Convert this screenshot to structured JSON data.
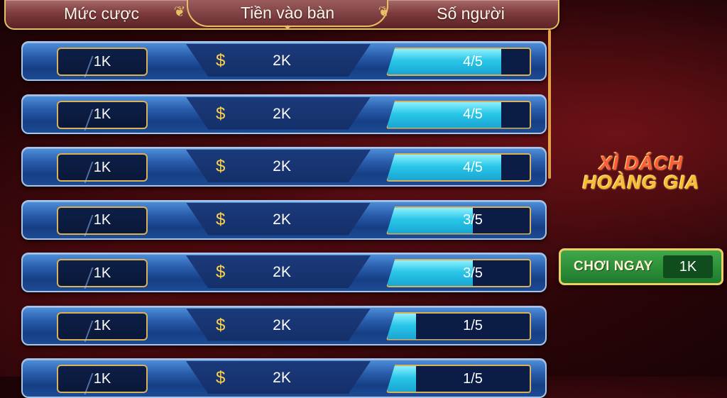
{
  "header": {
    "col_bet": "Mức cược",
    "col_entry": "Tiền vào bàn",
    "col_players": "Số người"
  },
  "rows": [
    {
      "bet": "1K",
      "currency": "$",
      "entry": "2K",
      "players": "4/5",
      "fill": 0.8
    },
    {
      "bet": "1K",
      "currency": "$",
      "entry": "2K",
      "players": "4/5",
      "fill": 0.8
    },
    {
      "bet": "1K",
      "currency": "$",
      "entry": "2K",
      "players": "4/5",
      "fill": 0.8
    },
    {
      "bet": "1K",
      "currency": "$",
      "entry": "2K",
      "players": "3/5",
      "fill": 0.6
    },
    {
      "bet": "1K",
      "currency": "$",
      "entry": "2K",
      "players": "3/5",
      "fill": 0.6
    },
    {
      "bet": "1K",
      "currency": "$",
      "entry": "2K",
      "players": "1/5",
      "fill": 0.2
    },
    {
      "bet": "1K",
      "currency": "$",
      "entry": "2K",
      "players": "1/5",
      "fill": 0.2
    }
  ],
  "logo": {
    "line1": "XÌ DÁCH",
    "line2": "HOÀNG GIA"
  },
  "play_now": {
    "label": "CHƠI NGAY",
    "amount": "1K"
  },
  "colors": {
    "gold": "#e8c063",
    "row_blue": "#2a5fae",
    "fill_cyan": "#29c7e8",
    "play_green": "#1e7a2c"
  }
}
